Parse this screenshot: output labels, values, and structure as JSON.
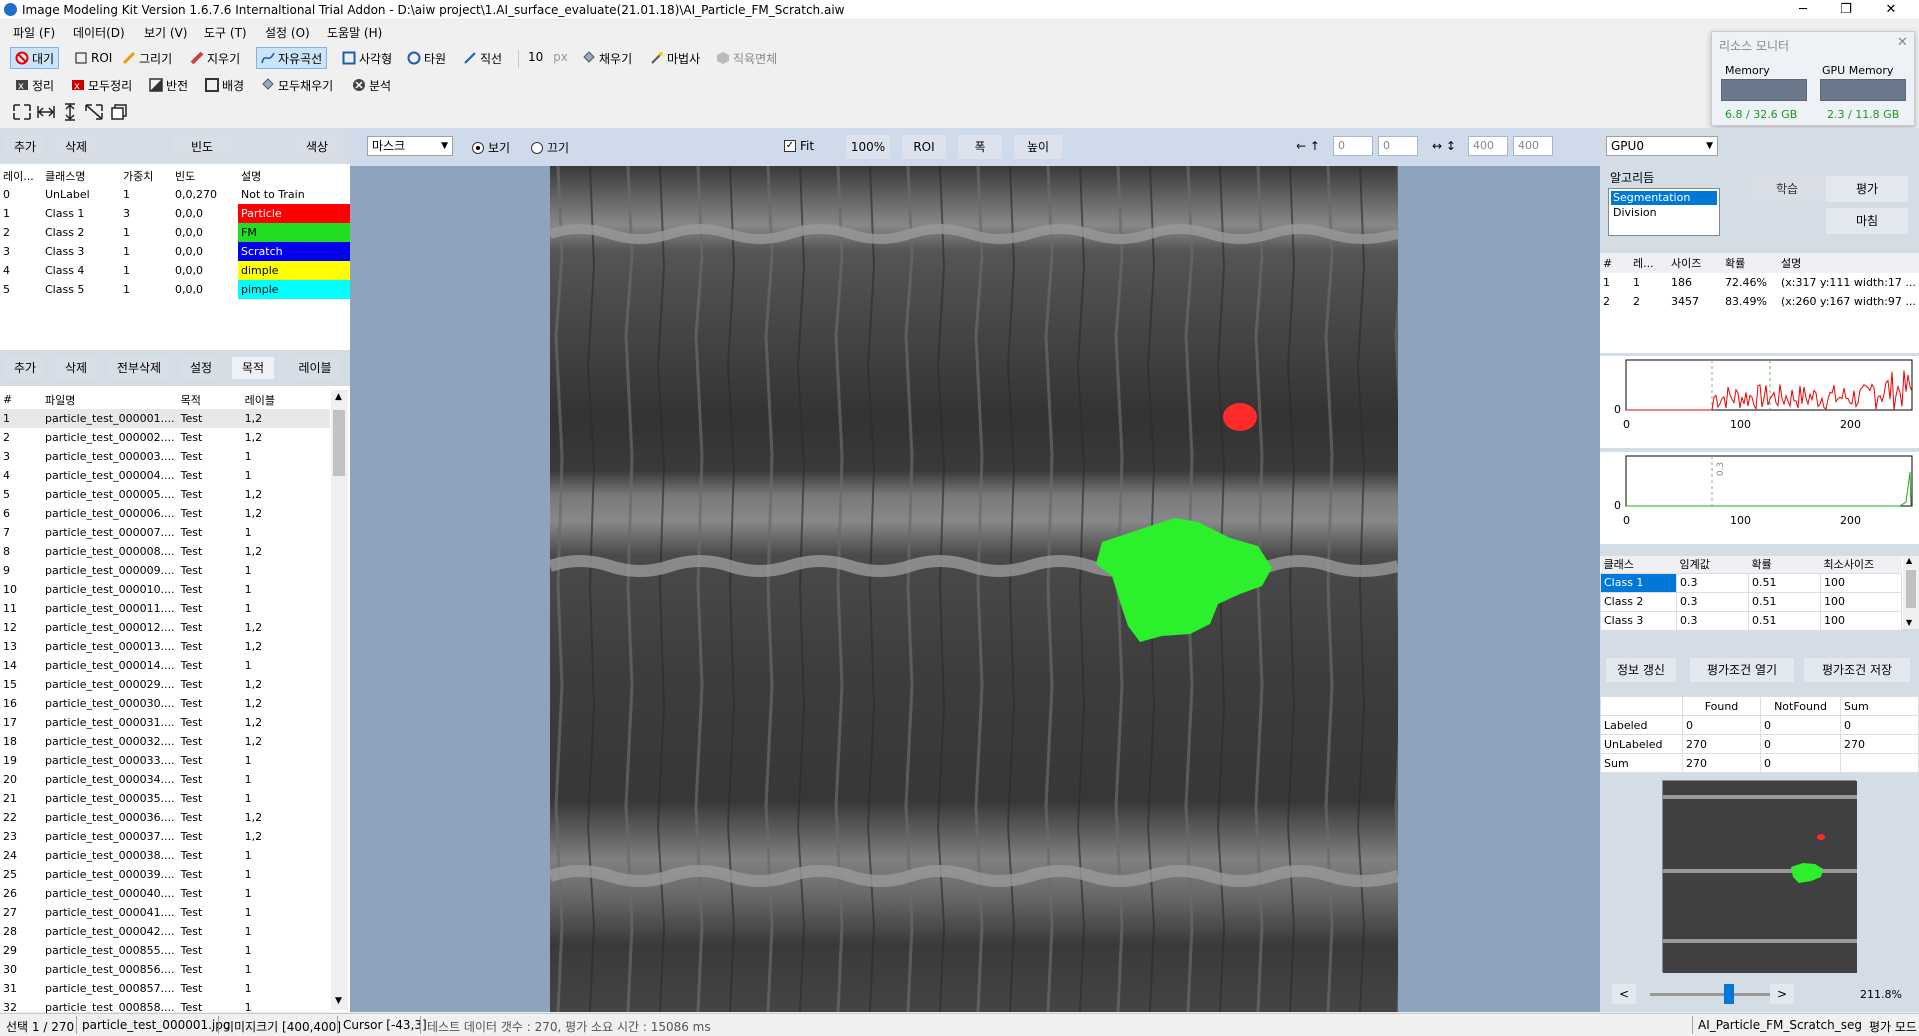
{
  "window": {
    "title": "Image Modeling Kit   Version 1.6.7.6  Internaltional Trial Addon    - D:\\aiw project\\1.AI_surface_evaluate(21.01.18)\\AI_Particle_FM_Scratch.aiw",
    "min": "─",
    "max": "❐",
    "close": "✕"
  },
  "menu": [
    "파일 (F)",
    "데이터(D)",
    "보기 (V)",
    "도구 (T)",
    "설정 (O)",
    "도움말 (H)"
  ],
  "toolbar1": {
    "wait": "대기",
    "roi": "ROI",
    "draw": "그리기",
    "erase": "지우기",
    "freecurve": "자유곡선",
    "rect": "사각형",
    "ellipse": "타원",
    "line": "직선",
    "px_value": "10",
    "px_unit": "px",
    "fill": "채우기",
    "magic": "마법사",
    "area": "직육면체"
  },
  "toolbar2": {
    "clean": "정리",
    "clean_all": "모두정리",
    "invert": "반전",
    "background": "배경",
    "fill_all": "모두채우기",
    "analyze": "분석"
  },
  "resource_monitor": {
    "title": "리소스 모니터",
    "memory_label": "Memory",
    "gpu_label": "GPU Memory",
    "memory_value": "6.8 / 32.6 GB",
    "gpu_value": "2.3 / 11.8 GB"
  },
  "class_panel": {
    "btn_add": "추가",
    "btn_delete": "삭제",
    "btn_freq": "빈도",
    "btn_color": "색상",
    "headers": [
      "레이...",
      "클래스명",
      "가중치",
      "빈도",
      "설명"
    ],
    "rows": [
      {
        "id": "0",
        "name": "UnLabel",
        "weight": "1",
        "freq": "0,0,270",
        "desc": "Not to Train",
        "color": "#ffffff"
      },
      {
        "id": "1",
        "name": "Class 1",
        "weight": "3",
        "freq": "0,0,0",
        "desc": "Particle",
        "color": "#ff0000"
      },
      {
        "id": "2",
        "name": "Class 2",
        "weight": "1",
        "freq": "0,0,0",
        "desc": "FM",
        "color": "#22dd22"
      },
      {
        "id": "3",
        "name": "Class 3",
        "weight": "1",
        "freq": "0,0,0",
        "desc": "Scratch",
        "color": "#0000ee"
      },
      {
        "id": "4",
        "name": "Class 4",
        "weight": "1",
        "freq": "0,0,0",
        "desc": "dimple",
        "color": "#ffff00"
      },
      {
        "id": "5",
        "name": "Class 5",
        "weight": "1",
        "freq": "0,0,0",
        "desc": "pimple",
        "color": "#00ffff"
      }
    ]
  },
  "file_panel": {
    "btn_add": "추가",
    "btn_delete": "삭제",
    "btn_delete_all": "전부삭제",
    "btn_settings": "설정",
    "btn_purpose": "목적",
    "btn_label": "레이블",
    "headers": [
      "#",
      "파일명",
      "목적",
      "레이블"
    ],
    "rows": [
      [
        "1",
        "particle_test_000001....",
        "Test",
        "1,2"
      ],
      [
        "2",
        "particle_test_000002....",
        "Test",
        "1,2"
      ],
      [
        "3",
        "particle_test_000003....",
        "Test",
        "1"
      ],
      [
        "4",
        "particle_test_000004....",
        "Test",
        "1"
      ],
      [
        "5",
        "particle_test_000005....",
        "Test",
        "1,2"
      ],
      [
        "6",
        "particle_test_000006....",
        "Test",
        "1,2"
      ],
      [
        "7",
        "particle_test_000007....",
        "Test",
        "1"
      ],
      [
        "8",
        "particle_test_000008....",
        "Test",
        "1,2"
      ],
      [
        "9",
        "particle_test_000009....",
        "Test",
        "1"
      ],
      [
        "10",
        "particle_test_000010....",
        "Test",
        "1"
      ],
      [
        "11",
        "particle_test_000011....",
        "Test",
        "1"
      ],
      [
        "12",
        "particle_test_000012....",
        "Test",
        "1,2"
      ],
      [
        "13",
        "particle_test_000013....",
        "Test",
        "1,2"
      ],
      [
        "14",
        "particle_test_000014....",
        "Test",
        "1"
      ],
      [
        "15",
        "particle_test_000029....",
        "Test",
        "1,2"
      ],
      [
        "16",
        "particle_test_000030....",
        "Test",
        "1,2"
      ],
      [
        "17",
        "particle_test_000031....",
        "Test",
        "1,2"
      ],
      [
        "18",
        "particle_test_000032....",
        "Test",
        "1,2"
      ],
      [
        "19",
        "particle_test_000033....",
        "Test",
        "1"
      ],
      [
        "20",
        "particle_test_000034....",
        "Test",
        "1"
      ],
      [
        "21",
        "particle_test_000035....",
        "Test",
        "1"
      ],
      [
        "22",
        "particle_test_000036....",
        "Test",
        "1,2"
      ],
      [
        "23",
        "particle_test_000037....",
        "Test",
        "1,2"
      ],
      [
        "24",
        "particle_test_000038....",
        "Test",
        "1"
      ],
      [
        "25",
        "particle_test_000039....",
        "Test",
        "1"
      ],
      [
        "26",
        "particle_test_000040....",
        "Test",
        "1"
      ],
      [
        "27",
        "particle_test_000041....",
        "Test",
        "1"
      ],
      [
        "28",
        "particle_test_000042....",
        "Test",
        "1"
      ],
      [
        "29",
        "particle_test_000855....",
        "Test",
        "1"
      ],
      [
        "30",
        "particle_test_000856....",
        "Test",
        "1"
      ],
      [
        "31",
        "particle_test_000857....",
        "Test",
        "1"
      ],
      [
        "32",
        "particle_test_000858....",
        "Test",
        "1"
      ]
    ]
  },
  "viewbar": {
    "mask_select": "마스크",
    "show": "보기",
    "hide": "끄기",
    "fit": "Fit",
    "zoom100": "100%",
    "roi": "ROI",
    "width": "폭",
    "height": "높이",
    "x_arrow": "← ↑",
    "x_val": "0",
    "y_val": "0",
    "size_arrow": "↔ ↕",
    "w_val": "400",
    "h_val": "400"
  },
  "right_panel": {
    "gpu_select": "GPU0",
    "algo_label": "알고리듬",
    "algos": [
      "Segmentation",
      "Division"
    ],
    "btn_train": "학습",
    "btn_eval": "평가",
    "btn_finish": "마침",
    "result_headers": [
      "#",
      "레...",
      "사이즈",
      "확률",
      "설명"
    ],
    "results": [
      [
        "1",
        "1",
        "186",
        "72.46%",
        "(x:317 y:111 width:17 ..."
      ],
      [
        "2",
        "2",
        "3457",
        "83.49%",
        "(x:260 y:167 width:97 ..."
      ]
    ],
    "hist_ticks": [
      "0",
      "100",
      "200"
    ],
    "hist_y0": "0",
    "hist2_marker": "0.3",
    "class_headers": [
      "클래스",
      "임계값",
      "확률",
      "최소사이즈"
    ],
    "class_rows": [
      [
        "Class 1",
        "0.3",
        "0.51",
        "100"
      ],
      [
        "Class 2",
        "0.3",
        "0.51",
        "100"
      ],
      [
        "Class 3",
        "0.3",
        "0.51",
        "100"
      ]
    ],
    "btn_refresh": "정보 갱신",
    "btn_open_cond": "평가조건 열기",
    "btn_save_cond": "평가조건 저장",
    "stat_headers": [
      "",
      "Found",
      "NotFound",
      "Sum"
    ],
    "stat_rows": [
      [
        "Labeled",
        "0",
        "0",
        "0"
      ],
      [
        "UnLabeled",
        "270",
        "0",
        "270"
      ],
      [
        "Sum",
        "270",
        "0",
        ""
      ]
    ],
    "nav_prev": "<",
    "nav_next": ">",
    "zoom_text": "211.8%",
    "zoom_slider": 0.6
  },
  "status": {
    "selection": "선택 1 / 270",
    "filename": "particle_test_000001.jpg",
    "imgsize": "이미지크기 [400,400]",
    "cursor": "Cursor [-43,3]",
    "test_count": "테스트 데이터 갯수 : 270,  평가 소요 시간 : 15086 ms",
    "model": "AI_Particle_FM_Scratch_seg",
    "mode": "평가 모드"
  },
  "colors": {
    "accent": "#0078d7",
    "particle": "#ff2222",
    "fm": "#22ee22"
  }
}
